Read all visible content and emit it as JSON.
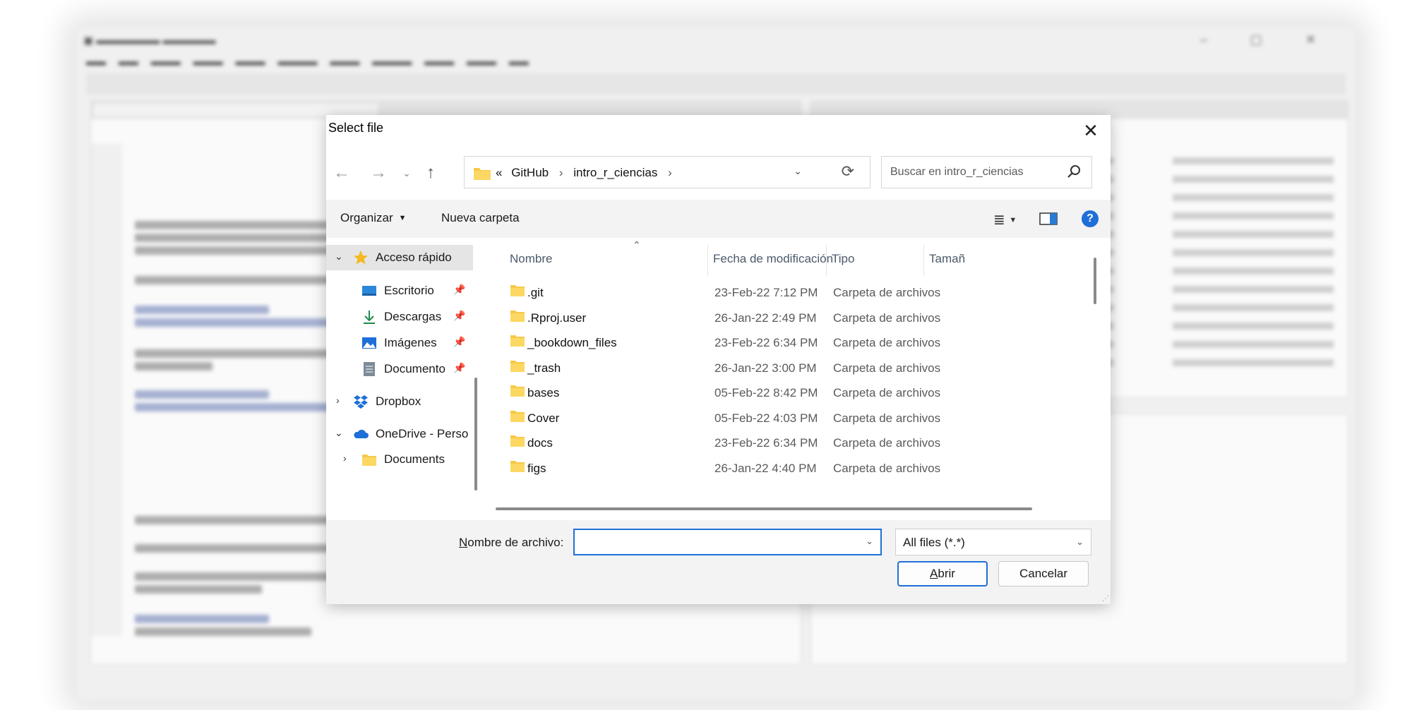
{
  "dialog": {
    "title": "Select file",
    "nav": {
      "back_icon": "arrow-left-icon",
      "forward_icon": "arrow-right-icon",
      "recent_icon": "chevron-down-icon",
      "up_icon": "arrow-up-icon"
    },
    "address": {
      "overflow": "«",
      "crumbs": [
        "GitHub",
        "intro_r_ciencias"
      ]
    },
    "search": {
      "placeholder": "Buscar en intro_r_ciencias"
    },
    "commands": {
      "organize": "Organizar",
      "new_folder": "Nueva carpeta"
    },
    "sidebar": [
      {
        "label": "Acceso rápido",
        "icon": "star-icon",
        "expanded": true,
        "selected": true
      },
      {
        "label": "Escritorio",
        "icon": "desktop-icon",
        "pinned": true
      },
      {
        "label": "Descargas",
        "icon": "download-icon",
        "pinned": true
      },
      {
        "label": "Imágenes",
        "icon": "images-icon",
        "pinned": true
      },
      {
        "label": "Documento",
        "icon": "document-icon",
        "pinned": true
      },
      {
        "label": "Dropbox",
        "icon": "dropbox-icon",
        "expanded": false
      },
      {
        "label": "OneDrive - Perso",
        "icon": "cloud-icon",
        "expanded": true
      },
      {
        "label": "Documents",
        "icon": "folder-icon",
        "expanded": false
      }
    ],
    "columns": {
      "name": "Nombre",
      "modified": "Fecha de modificación",
      "type": "Tipo",
      "size": "Tamañ"
    },
    "files": [
      {
        "name": ".git",
        "modified": "23-Feb-22 7:12 PM",
        "type": "Carpeta de archivos"
      },
      {
        "name": ".Rproj.user",
        "modified": "26-Jan-22 2:49 PM",
        "type": "Carpeta de archivos"
      },
      {
        "name": "_bookdown_files",
        "modified": "23-Feb-22 6:34 PM",
        "type": "Carpeta de archivos"
      },
      {
        "name": "_trash",
        "modified": "26-Jan-22 3:00 PM",
        "type": "Carpeta de archivos"
      },
      {
        "name": "bases",
        "modified": "05-Feb-22 8:42 PM",
        "type": "Carpeta de archivos"
      },
      {
        "name": "Cover",
        "modified": "05-Feb-22 4:03 PM",
        "type": "Carpeta de archivos"
      },
      {
        "name": "docs",
        "modified": "23-Feb-22 6:34 PM",
        "type": "Carpeta de archivos"
      },
      {
        "name": "figs",
        "modified": "26-Jan-22 4:40 PM",
        "type": "Carpeta de archivos"
      }
    ],
    "filename": {
      "label_first": "N",
      "label_rest": "ombre de archivo:",
      "value": ""
    },
    "filter": {
      "value": "All files (*.*)"
    },
    "buttons": {
      "open_first": "A",
      "open_rest": "brir",
      "cancel": "Cancelar"
    },
    "colors": {
      "accent": "#1f6fd8",
      "folder": "#f7c948",
      "selected": "#e5e5e5"
    }
  }
}
